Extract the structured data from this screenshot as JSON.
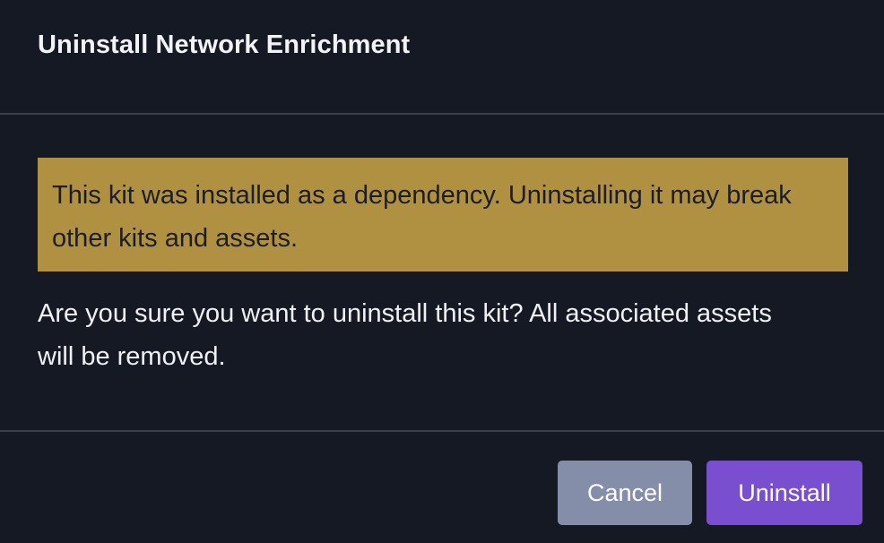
{
  "dialog": {
    "title": "Uninstall Network Enrichment",
    "warning": "This kit was installed as a dependency. Uninstalling it may break other kits and assets.",
    "confirmation": "Are you sure you want to uninstall this kit? All associated assets will be removed.",
    "buttons": {
      "cancel_label": "Cancel",
      "uninstall_label": "Uninstall"
    }
  },
  "colors": {
    "background": "#141923",
    "warning_background": "#b09142",
    "cancel_button": "#858ea8",
    "uninstall_button": "#7a4fcf",
    "divider": "#3a3f4a"
  }
}
